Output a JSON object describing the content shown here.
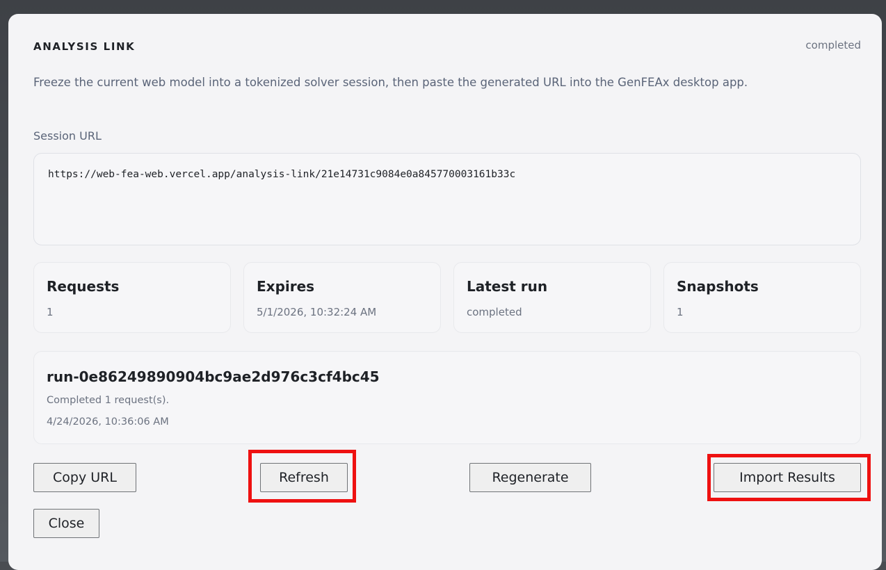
{
  "dialog": {
    "title": "ANALYSIS LINK",
    "status": "completed",
    "description": "Freeze the current web model into a tokenized solver session, then paste the generated URL into the GenFEAx desktop app.",
    "session_url_label": "Session URL",
    "session_url": "https://web-fea-web.vercel.app/analysis-link/21e14731c9084e0a845770003161b33c"
  },
  "stats": [
    {
      "title": "Requests",
      "value": "1"
    },
    {
      "title": "Expires",
      "value": "5/1/2026, 10:32:24 AM"
    },
    {
      "title": "Latest run",
      "value": "completed"
    },
    {
      "title": "Snapshots",
      "value": "1"
    }
  ],
  "run": {
    "id": "run-0e86249890904bc9ae2d976c3cf4bc45",
    "message": "Completed 1 request(s).",
    "timestamp": "4/24/2026, 10:36:06 AM"
  },
  "buttons": {
    "copy_url": "Copy URL",
    "refresh": "Refresh",
    "regenerate": "Regenerate",
    "import_results": "Import Results",
    "close": "Close"
  },
  "colors": {
    "highlight": "#ee1111",
    "panel_background": "#f4f4f6",
    "text_primary": "#1e2126",
    "text_muted": "#6b7280"
  }
}
